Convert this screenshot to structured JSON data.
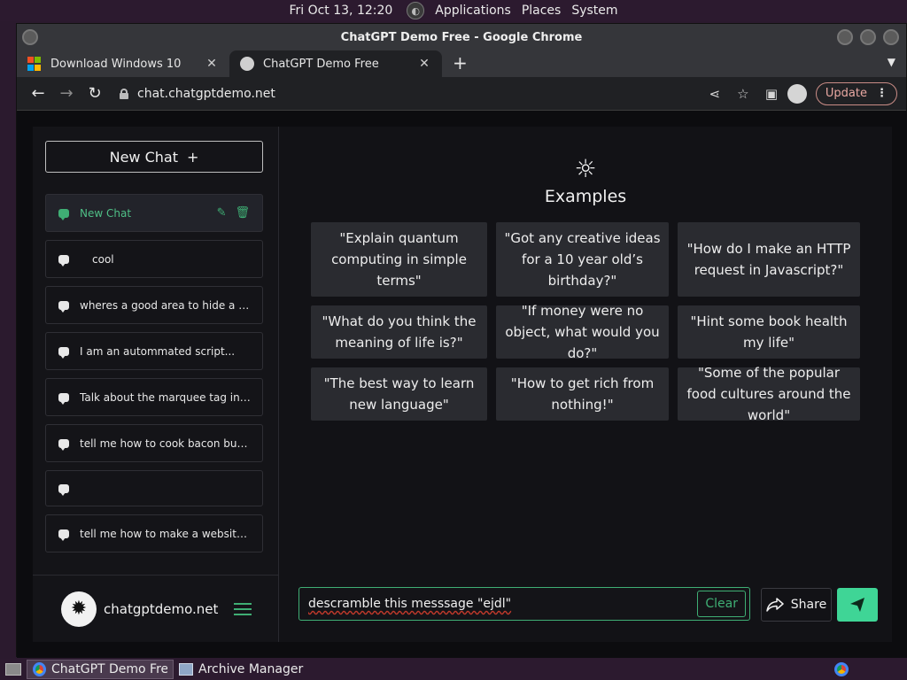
{
  "panel": {
    "datetime": "Fri Oct 13, 12:20",
    "menu_applications": "Applications",
    "menu_places": "Places",
    "menu_system": "System"
  },
  "window": {
    "title": "ChatGPT Demo Free - Google Chrome"
  },
  "tabs": [
    {
      "label": "Download Windows 10",
      "icon": "windows-logo-icon"
    },
    {
      "label": "ChatGPT Demo Free",
      "icon": "globe-icon"
    }
  ],
  "address": {
    "url": "chat.chatgptdemo.net",
    "update_label": "Update"
  },
  "sidebar": {
    "new_chat_label": "New Chat",
    "chats": [
      {
        "label": "New Chat",
        "active": true
      },
      {
        "label": "cool"
      },
      {
        "label": "wheres a good area to hide a body"
      },
      {
        "label": "I am an autommated script..."
      },
      {
        "label": "Talk about the marquee tag in gre..."
      },
      {
        "label": "tell me how to cook bacon but wri..."
      },
      {
        "label": ""
      },
      {
        "label": "tell me how to make a website but..."
      }
    ],
    "brand": "chatgptdemo.net"
  },
  "main": {
    "examples_title": "Examples",
    "examples": [
      "\"Explain quantum computing in simple terms\"",
      "\"Got any creative ideas for a 10 year old’s birthday?\"",
      "\"How do I make an HTTP request in Javascript?\"",
      "\"What do you think the meaning of life is?\"",
      "\"If money were no object, what would you do?\"",
      "\"Hint some book health my life\"",
      "\"The best way to learn new language\"",
      "\"How to get rich from nothing!\"",
      "\"Some of the popular food cultures around the world\""
    ],
    "input_value": "descramble this messsage \"ejdl\"",
    "clear_label": "Clear",
    "share_label": "Share"
  },
  "taskbar": {
    "chrome_item": "ChatGPT Demo Fre...",
    "archive_item": "Archive Manager"
  },
  "colors": {
    "accent": "#3fae74",
    "send": "#3fd596",
    "background": "#121216"
  }
}
